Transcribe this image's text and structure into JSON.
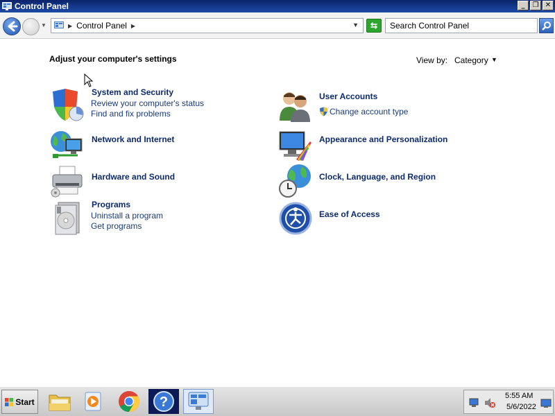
{
  "window": {
    "title": "Control Panel",
    "controls": [
      "_",
      "❐",
      "✕"
    ]
  },
  "nav": {
    "breadcrumb": "Control Panel",
    "search_placeholder": "Search Control Panel"
  },
  "content": {
    "heading": "Adjust your computer's settings",
    "view_by_label": "View by:",
    "view_by_value": "Category",
    "categories": [
      {
        "title": "System and Security",
        "links": [
          "Review your computer's status",
          "Find and fix problems"
        ],
        "icon": "shield-icon"
      },
      {
        "title": "Network and Internet",
        "links": [],
        "icon": "network-icon"
      },
      {
        "title": "Hardware and Sound",
        "links": [],
        "icon": "printer-icon"
      },
      {
        "title": "Programs",
        "links": [
          "Uninstall a program",
          "Get programs"
        ],
        "icon": "programs-icon"
      },
      {
        "title": "User Accounts",
        "links": [
          "Change account type"
        ],
        "icon": "users-icon"
      },
      {
        "title": "Appearance and Personalization",
        "links": [],
        "icon": "appearance-icon"
      },
      {
        "title": "Clock, Language, and Region",
        "links": [],
        "icon": "clock-globe-icon"
      },
      {
        "title": "Ease of Access",
        "links": [],
        "icon": "ease-of-access-icon"
      }
    ]
  },
  "taskbar": {
    "start_label": "Start",
    "items": [
      "file-explorer-icon",
      "media-player-icon",
      "chrome-icon",
      "help-icon",
      "control-panel-icon"
    ],
    "time": "5:55 AM",
    "date": "5/6/2022"
  },
  "colors": {
    "link": "#1a3a7a",
    "title_bar": "#0a246a"
  }
}
